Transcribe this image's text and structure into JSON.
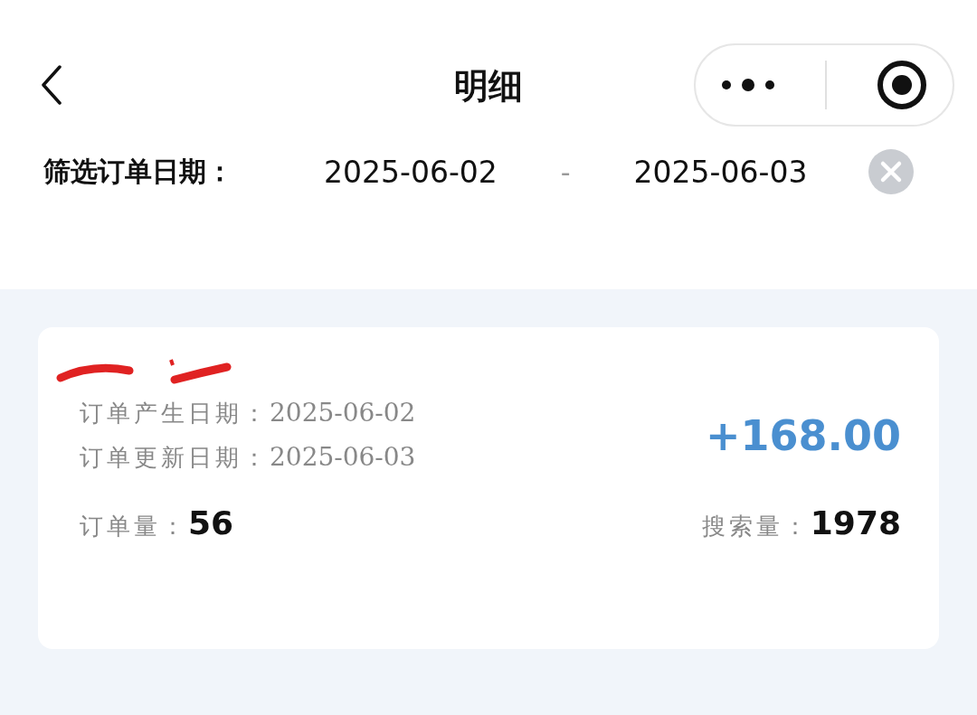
{
  "header": {
    "title": "明细"
  },
  "filter": {
    "label": "筛选订单日期：",
    "start_date": "2025-06-02",
    "separator": "-",
    "end_date": "2025-06-03"
  },
  "orders": [
    {
      "created_label": "订单产生日期：",
      "created_date": "2025-06-02",
      "updated_label": "订单更新日期：",
      "updated_date": "2025-06-03",
      "amount": "+168.00",
      "order_count_label": "订单量：",
      "order_count": "56",
      "search_count_label": "搜索量：",
      "search_count": "1978"
    }
  ]
}
